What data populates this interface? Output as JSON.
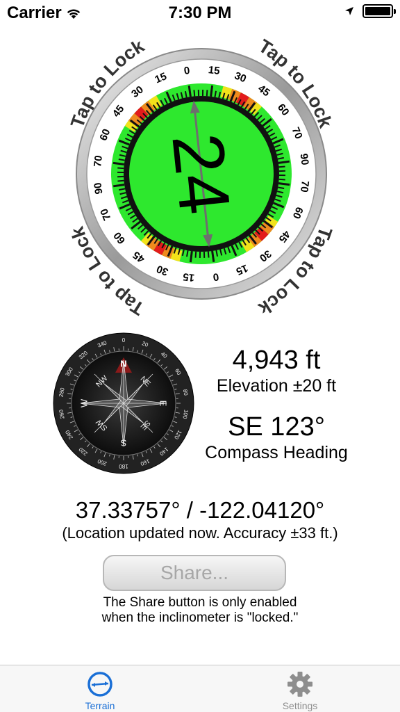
{
  "status_bar": {
    "carrier": "Carrier",
    "time": "7:30 PM",
    "icons": [
      "wifi-icon",
      "location-arrow-icon",
      "battery-icon"
    ]
  },
  "inclinometer": {
    "reading": "24",
    "lock_label": "Tap to Lock",
    "scale_labels": [
      "0",
      "15",
      "30",
      "45",
      "60",
      "70",
      "90"
    ],
    "colors": {
      "face": "#2ee82e",
      "warn_orange": "#ef8a1e",
      "warn_red": "#e31b1b",
      "warn_yellow": "#f2e21a",
      "bezel": "#b9b9b9"
    }
  },
  "compass": {
    "cardinals": [
      "N",
      "NE",
      "E",
      "SE",
      "S",
      "SW",
      "W",
      "NW"
    ],
    "dial_labels": [
      "0",
      "20",
      "40",
      "60",
      "80",
      "100",
      "120",
      "140",
      "160",
      "180",
      "200",
      "220",
      "240",
      "260",
      "280",
      "300",
      "320",
      "340"
    ]
  },
  "readouts": {
    "elevation_value": "4,943 ft",
    "elevation_label": "Elevation ±20 ft",
    "heading_value": "SE 123°",
    "heading_label": "Compass Heading"
  },
  "location": {
    "coordinates": "37.33757° / -122.04120°",
    "note": "(Location updated now. Accuracy ±33 ft.)"
  },
  "share": {
    "label": "Share...",
    "hint_line1": "The Share button is only enabled",
    "hint_line2": "when the inclinometer is \"locked.\""
  },
  "tabs": [
    {
      "label": "Terrain",
      "icon": "terrain-icon",
      "active": true
    },
    {
      "label": "Settings",
      "icon": "gear-icon",
      "active": false
    }
  ]
}
